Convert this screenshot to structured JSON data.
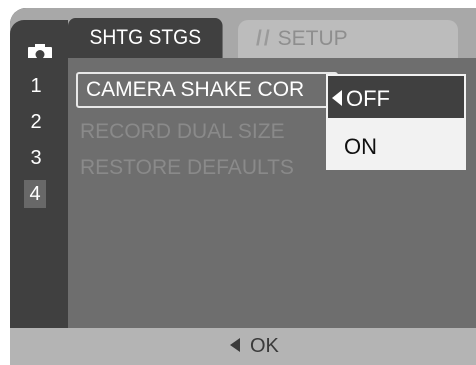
{
  "tabs": {
    "camera_icon": "camera-icon",
    "shooting": "SHTG STGS",
    "setup_icon": "wrench-icon",
    "setup": "SETUP"
  },
  "pages": [
    "1",
    "2",
    "3",
    "4"
  ],
  "active_page": "4",
  "menu": {
    "items": [
      {
        "label": "CAMERA SHAKE COR"
      },
      {
        "label": "RECORD DUAL SIZE"
      },
      {
        "label": "RESTORE DEFAULTS"
      }
    ]
  },
  "dropdown": {
    "options": [
      "OFF",
      "ON"
    ],
    "selected": "OFF"
  },
  "footer": {
    "ok_label": "OK"
  },
  "colors": {
    "screen_bg": "#404040",
    "menu_bg": "#6e6e6e",
    "tab_band": "#a8a8a8",
    "dropdown_bg": "#f2f2f2"
  }
}
